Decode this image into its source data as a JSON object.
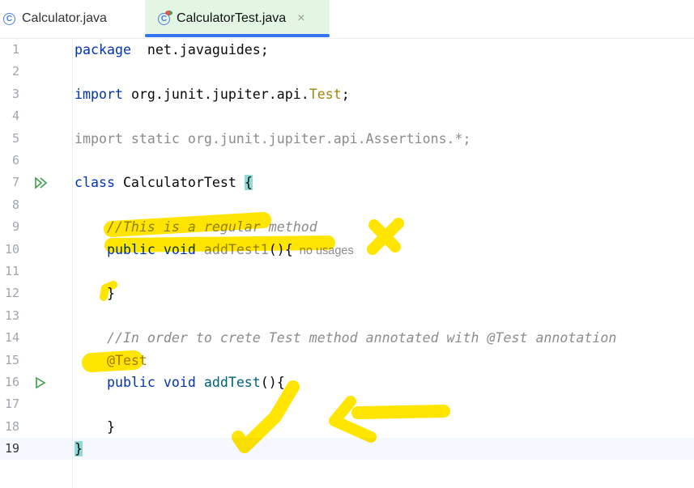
{
  "tabs": [
    {
      "label": "Calculator.java",
      "icon": "class-icon",
      "active": false
    },
    {
      "label": "CalculatorTest.java",
      "icon": "test-class-icon",
      "active": true,
      "close": "×"
    }
  ],
  "colors": {
    "keyword": "#0033b3",
    "comment": "#8c8c8c",
    "annotation": "#9e880d",
    "method": "#00627a",
    "highlighter": "#ffe500",
    "active_tab": "#e3f5e3",
    "tab_underline": "#3574f0"
  },
  "lines": [
    {
      "n": "1",
      "tokens": [
        [
          "kw",
          "package"
        ],
        [
          "",
          "  net.javaguides;"
        ]
      ]
    },
    {
      "n": "2",
      "tokens": []
    },
    {
      "n": "3",
      "tokens": [
        [
          "kw",
          "import"
        ],
        [
          "",
          " org.junit.jupiter.api."
        ],
        [
          "an",
          "Test"
        ],
        [
          "",
          ";"
        ]
      ]
    },
    {
      "n": "4",
      "tokens": []
    },
    {
      "n": "5",
      "tokens": [
        [
          "gr",
          "import static org.junit.jupiter.api.Assertions.*;"
        ]
      ]
    },
    {
      "n": "6",
      "tokens": []
    },
    {
      "n": "7",
      "run": "run-all-icon",
      "tokens": [
        [
          "kw",
          "class"
        ],
        [
          "",
          " CalculatorTest "
        ],
        [
          "br",
          "{"
        ]
      ]
    },
    {
      "n": "8",
      "tokens": []
    },
    {
      "n": "9",
      "tokens": [
        [
          "cm",
          "    //This is a regular method"
        ]
      ]
    },
    {
      "n": "10",
      "tokens": [
        [
          "kw",
          "    public void "
        ],
        [
          "un",
          "addTest1"
        ],
        [
          "",
          "(){"
        ],
        [
          "hint",
          "no usages"
        ]
      ]
    },
    {
      "n": "11",
      "tokens": []
    },
    {
      "n": "12",
      "tokens": [
        [
          "",
          "    }"
        ]
      ]
    },
    {
      "n": "13",
      "tokens": []
    },
    {
      "n": "14",
      "tokens": [
        [
          "cm",
          "    //In order to crete Test method annotated with @Test annotation"
        ]
      ]
    },
    {
      "n": "15",
      "tokens": [
        [
          "an",
          "    @Test"
        ]
      ]
    },
    {
      "n": "16",
      "run": "run-test-icon",
      "tokens": [
        [
          "kw",
          "    public void "
        ],
        [
          "fn",
          "addTest"
        ],
        [
          "",
          "(){"
        ]
      ]
    },
    {
      "n": "17",
      "tokens": []
    },
    {
      "n": "18",
      "tokens": [
        [
          "",
          "    }"
        ]
      ]
    },
    {
      "n": "19",
      "current": true,
      "tokens": [
        [
          "br",
          "}"
        ]
      ]
    }
  ]
}
